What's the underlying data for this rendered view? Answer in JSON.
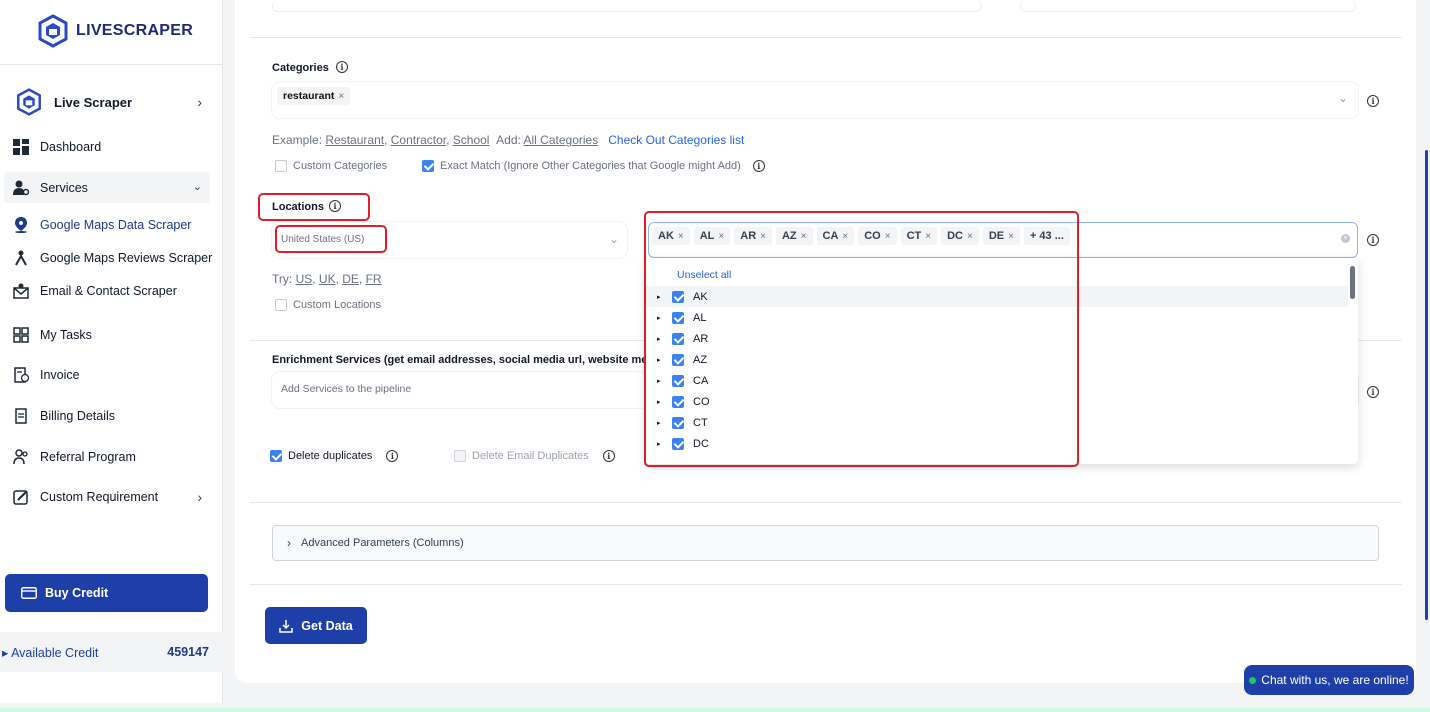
{
  "brand": {
    "name_part1": "LIVE",
    "name_part2": "SCRAPER"
  },
  "sidebar": {
    "product": "Live Scraper",
    "items": [
      {
        "label": "Dashboard",
        "icon": "dashboard-icon"
      },
      {
        "label": "Services",
        "icon": "services-icon"
      },
      {
        "label": "Google Maps Data Scraper",
        "icon": "map-pin-icon"
      },
      {
        "label": "Google Maps Reviews Scraper",
        "icon": "reviews-icon"
      },
      {
        "label": "Email & Contact Scraper",
        "icon": "email-icon"
      },
      {
        "label": "My Tasks",
        "icon": "tasks-icon"
      },
      {
        "label": "Invoice",
        "icon": "invoice-icon"
      },
      {
        "label": "Billing Details",
        "icon": "billing-icon"
      },
      {
        "label": "Referral Program",
        "icon": "referral-icon"
      },
      {
        "label": "Custom Requirement",
        "icon": "custom-icon"
      }
    ],
    "buy_credit": "Buy Credit",
    "available_credit_label": "Available Credit",
    "available_credit_value": "459147"
  },
  "categories": {
    "label": "Categories",
    "selected_tag": "restaurant",
    "example_prefix": "Example:",
    "examples": [
      "Restaurant",
      "Contractor",
      "School"
    ],
    "add_prefix": "Add:",
    "add_all": "All Categories",
    "check_link": "Check Out Categories list",
    "custom_label": "Custom Categories",
    "exact_match_label": "Exact Match (Ignore Other Categories that Google might Add)"
  },
  "locations": {
    "label": "Locations",
    "country_value": "United States (US)",
    "try_prefix": "Try:",
    "try_options": [
      "US",
      "UK",
      "DE",
      "FR"
    ],
    "custom_label": "Custom Locations",
    "selected_chips": [
      "AK",
      "AL",
      "AR",
      "AZ",
      "CA",
      "CO",
      "CT",
      "DC",
      "DE"
    ],
    "more_chip": "+ 43 ...",
    "unselect_all": "Unselect all",
    "options": [
      "AK",
      "AL",
      "AR",
      "AZ",
      "CA",
      "CO",
      "CT",
      "DC"
    ]
  },
  "enrichment": {
    "label": "Enrichment Services (get email addresses, social media url, website meteda",
    "placeholder": "Add Services to the pipeline"
  },
  "options": {
    "delete_duplicates": "Delete duplicates",
    "delete_email_duplicates": "Delete Email Duplicates"
  },
  "advanced": {
    "label": "Advanced Parameters (Columns)"
  },
  "get_data": "Get Data",
  "chat": "Chat with us, we are online!",
  "colors": {
    "primary": "#1e3fa8",
    "highlight": "#e11d2b",
    "checkbox": "#3b82f6"
  }
}
